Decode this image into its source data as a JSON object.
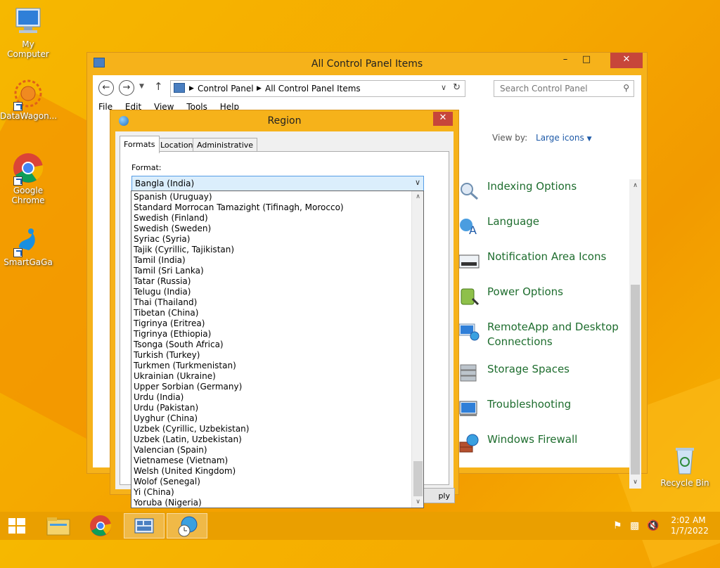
{
  "desktop": {
    "icons": [
      {
        "label": "My Computer"
      },
      {
        "label": "DataWagon..."
      },
      {
        "label": "Google Chrome"
      },
      {
        "label": "SmartGaGa"
      },
      {
        "label": "Recycle Bin"
      }
    ]
  },
  "control_panel": {
    "title": "All Control Panel Items",
    "breadcrumb": [
      "Control Panel",
      "All Control Panel Items"
    ],
    "search_placeholder": "Search Control Panel",
    "menu": [
      "File",
      "Edit",
      "View",
      "Tools",
      "Help"
    ],
    "view_by_label": "View by:",
    "view_by_value": "Large icons",
    "items": [
      {
        "label": "Indexing Options",
        "icon": "indexing-icon"
      },
      {
        "label": "Language",
        "icon": "language-icon"
      },
      {
        "label": "Notification Area Icons",
        "icon": "notification-area-icon"
      },
      {
        "label": "Power Options",
        "icon": "power-icon"
      },
      {
        "label": "RemoteApp and Desktop Connections",
        "icon": "remoteapp-icon"
      },
      {
        "label": "Storage Spaces",
        "icon": "storage-icon"
      },
      {
        "label": "Troubleshooting",
        "icon": "troubleshooting-icon"
      },
      {
        "label": "Windows Firewall",
        "icon": "firewall-icon"
      }
    ]
  },
  "region_dialog": {
    "title": "Region",
    "tabs": [
      "Formats",
      "Location",
      "Administrative"
    ],
    "format_label": "Format:",
    "format_value": "Bangla (India)",
    "apply_label_partial": "ply",
    "dropdown_options": [
      "Spanish (Uruguay)",
      "Standard Morrocan Tamazight (Tifinagh, Morocco)",
      "Swedish (Finland)",
      "Swedish (Sweden)",
      "Syriac (Syria)",
      "Tajik (Cyrillic, Tajikistan)",
      "Tamil (India)",
      "Tamil (Sri Lanka)",
      "Tatar (Russia)",
      "Telugu (India)",
      "Thai (Thailand)",
      "Tibetan (China)",
      "Tigrinya (Eritrea)",
      "Tigrinya (Ethiopia)",
      "Tsonga (South Africa)",
      "Turkish (Turkey)",
      "Turkmen (Turkmenistan)",
      "Ukrainian (Ukraine)",
      "Upper Sorbian (Germany)",
      "Urdu (India)",
      "Urdu (Pakistan)",
      "Uyghur (China)",
      "Uzbek (Cyrillic, Uzbekistan)",
      "Uzbek (Latin, Uzbekistan)",
      "Valencian (Spain)",
      "Vietnamese (Vietnam)",
      "Welsh (United Kingdom)",
      "Wolof (Senegal)",
      "Yi (China)",
      "Yoruba (Nigeria)"
    ]
  },
  "taskbar": {
    "time": "2:02 AM",
    "date": "1/7/2022"
  },
  "colors": {
    "accent_orange": "#f6b21a",
    "close_red": "#c7463a",
    "link_green": "#1e6d2e",
    "link_blue": "#1e5aa8"
  }
}
